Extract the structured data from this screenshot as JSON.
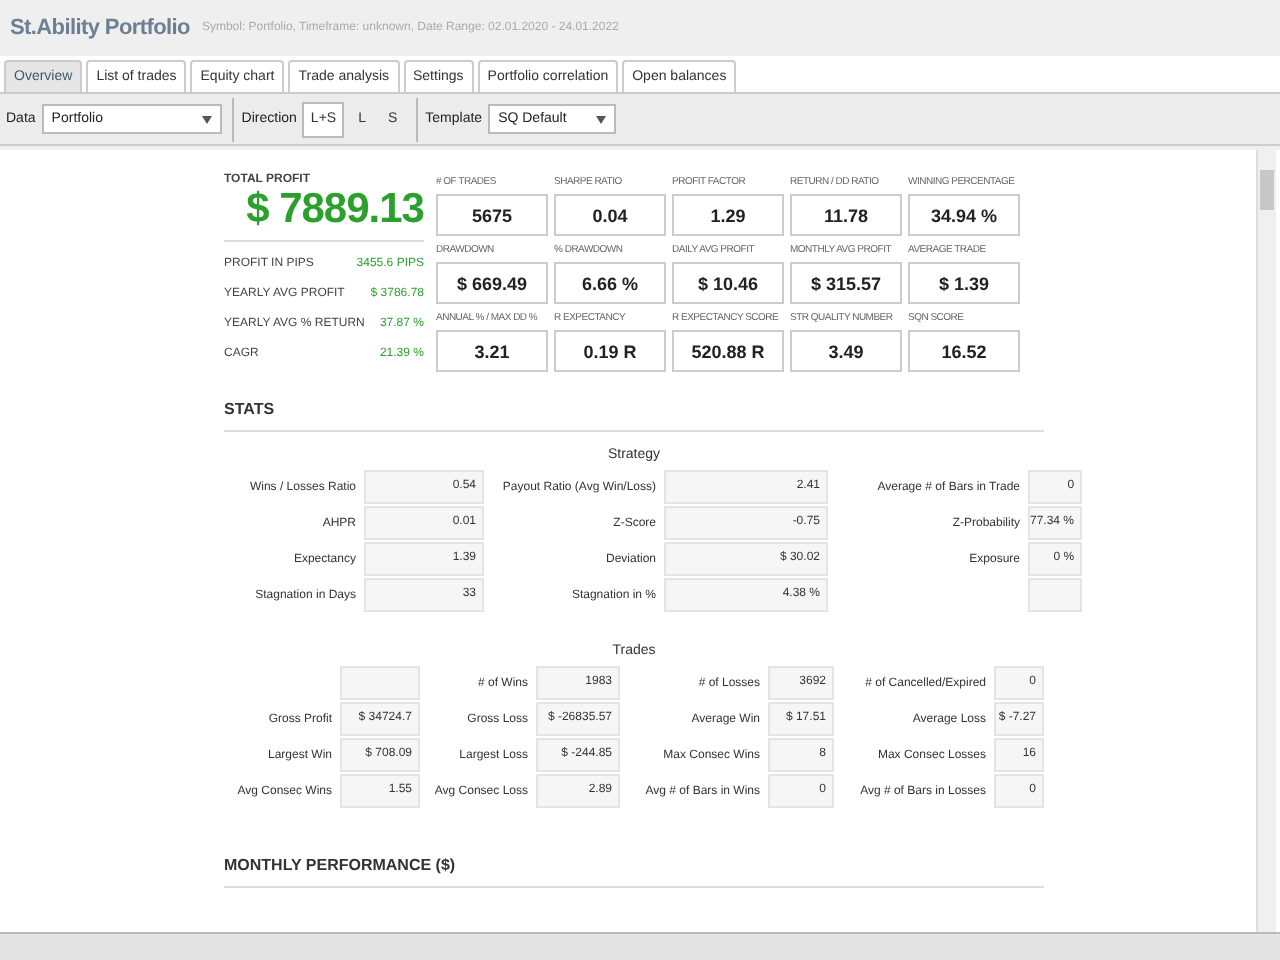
{
  "header": {
    "title": "St.Ability Portfolio",
    "subtitle": "Symbol: Portfolio, Timeframe: unknown, Date Range: 02.01.2020 - 24.01.2022"
  },
  "tabs": [
    {
      "label": "Overview",
      "selected": true
    },
    {
      "label": "List of trades",
      "selected": false
    },
    {
      "label": "Equity chart",
      "selected": false
    },
    {
      "label": "Trade analysis",
      "selected": false
    },
    {
      "label": "Settings",
      "selected": false
    },
    {
      "label": "Portfolio correlation",
      "selected": false
    },
    {
      "label": "Open balances",
      "selected": false
    }
  ],
  "toolbar": {
    "data": {
      "label": "Data",
      "value": "Portfolio"
    },
    "direction": {
      "label": "Direction",
      "options": [
        {
          "label": "L+S",
          "selected": true
        },
        {
          "label": "L",
          "selected": false
        },
        {
          "label": "S",
          "selected": false
        }
      ]
    },
    "template": {
      "label": "Template",
      "value": "SQ Default"
    }
  },
  "summary": {
    "title": "TOTAL PROFIT",
    "total": "$ 7889.13",
    "rows": [
      {
        "label": "PROFIT IN PIPS",
        "value": "3455.6 PIPS"
      },
      {
        "label": "YEARLY AVG PROFIT",
        "value": "$ 3786.78"
      },
      {
        "label": "YEARLY AVG % RETURN",
        "value": "37.87 %"
      },
      {
        "label": "CAGR",
        "value": "21.39 %"
      }
    ]
  },
  "metrics": [
    {
      "label": "# OF TRADES",
      "value": "5675"
    },
    {
      "label": "SHARPE RATIO",
      "value": "0.04"
    },
    {
      "label": "PROFIT FACTOR",
      "value": "1.29"
    },
    {
      "label": "RETURN / DD RATIO",
      "value": "11.78"
    },
    {
      "label": "WINNING PERCENTAGE",
      "value": "34.94 %"
    },
    {
      "label": "DRAWDOWN",
      "value": "$ 669.49"
    },
    {
      "label": "% DRAWDOWN",
      "value": "6.66 %"
    },
    {
      "label": "DAILY AVG PROFIT",
      "value": "$ 10.46"
    },
    {
      "label": "MONTHLY AVG PROFIT",
      "value": "$ 315.57"
    },
    {
      "label": "AVERAGE TRADE",
      "value": "$ 1.39"
    },
    {
      "label": "ANNUAL % / MAX DD %",
      "value": "3.21"
    },
    {
      "label": "R EXPECTANCY",
      "value": "0.19 R"
    },
    {
      "label": "R EXPECTANCY SCORE",
      "value": "520.88 R"
    },
    {
      "label": "STR QUALITY NUMBER",
      "value": "3.49"
    },
    {
      "label": "SQN SCORE",
      "value": "16.52"
    }
  ],
  "stats": {
    "title": "STATS",
    "strategy": {
      "title": "Strategy",
      "rows": [
        [
          {
            "kind": "pair",
            "label": "Wins / Losses Ratio",
            "value": "0.54"
          },
          {
            "kind": "pair",
            "label": "Payout Ratio (Avg Win/Loss)",
            "value": "2.41"
          },
          {
            "kind": "pair",
            "label": "Average # of Bars in Trade",
            "value": "0"
          }
        ],
        [
          {
            "kind": "pair",
            "label": "AHPR",
            "value": "0.01"
          },
          {
            "kind": "pair",
            "label": "Z-Score",
            "value": "-0.75"
          },
          {
            "kind": "pair",
            "label": "Z-Probability",
            "value": "77.34 %"
          }
        ],
        [
          {
            "kind": "pair",
            "label": "Expectancy",
            "value": "1.39"
          },
          {
            "kind": "pair",
            "label": "Deviation",
            "value": "$ 30.02"
          },
          {
            "kind": "pair",
            "label": "Exposure",
            "value": "0 %"
          }
        ],
        [
          {
            "kind": "pair",
            "label": "Stagnation in Days",
            "value": "33"
          },
          {
            "kind": "pair",
            "label": "Stagnation in %",
            "value": "4.38 %"
          },
          {
            "kind": "blank"
          }
        ]
      ]
    },
    "trades": {
      "title": "Trades",
      "rows": [
        [
          {
            "kind": "blank"
          },
          {
            "kind": "pair",
            "label": "# of Wins",
            "value": "1983"
          },
          {
            "kind": "pair",
            "label": "# of Losses",
            "value": "3692"
          },
          {
            "kind": "pair",
            "label": "# of Cancelled/Expired",
            "value": "0"
          }
        ],
        [
          {
            "kind": "pair",
            "label": "Gross Profit",
            "value": "$ 34724.7"
          },
          {
            "kind": "pair",
            "label": "Gross Loss",
            "value": "$ -26835.57"
          },
          {
            "kind": "pair",
            "label": "Average Win",
            "value": "$ 17.51"
          },
          {
            "kind": "pair",
            "label": "Average Loss",
            "value": "$ -7.27"
          }
        ],
        [
          {
            "kind": "pair",
            "label": "Largest Win",
            "value": "$ 708.09"
          },
          {
            "kind": "pair",
            "label": "Largest Loss",
            "value": "$ -244.85"
          },
          {
            "kind": "pair",
            "label": "Max Consec Wins",
            "value": "8"
          },
          {
            "kind": "pair",
            "label": "Max Consec Losses",
            "value": "16"
          }
        ],
        [
          {
            "kind": "pair",
            "label": "Avg Consec Wins",
            "value": "1.55"
          },
          {
            "kind": "pair",
            "label": "Avg Consec Loss",
            "value": "2.89"
          },
          {
            "kind": "pair",
            "label": "Avg # of Bars in Wins",
            "value": "0"
          },
          {
            "kind": "pair",
            "label": "Avg # of Bars in Losses",
            "value": "0"
          }
        ]
      ]
    }
  },
  "monthly": {
    "title": "MONTHLY PERFORMANCE ($)"
  }
}
